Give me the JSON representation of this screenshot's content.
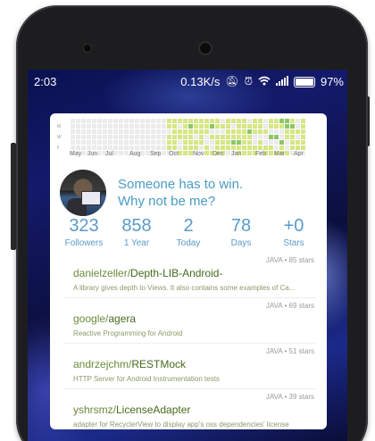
{
  "status_bar": {
    "time": "2:03",
    "net_speed": "0.13K/s",
    "battery_percent": "97%"
  },
  "contribution_graph": {
    "day_labels": [
      "M",
      "W",
      "F"
    ],
    "month_labels": [
      "May",
      "Jun",
      "Jul",
      "Aug",
      "Sep",
      "Oct",
      "Nov",
      "Dec",
      "Jan",
      "Feb",
      "Mar",
      "Apr"
    ],
    "colors": {
      "empty": "#ebebeb",
      "l1": "#d6e685",
      "l2": "#8cc665",
      "l3": "#44a340",
      "l4": "#1e6823"
    }
  },
  "profile": {
    "quote_line1": "Someone has to win.",
    "quote_line2": "Why not be me?"
  },
  "stats": [
    {
      "value": "323",
      "label": "Followers"
    },
    {
      "value": "858",
      "label": "1 Year"
    },
    {
      "value": "2",
      "label": "Today"
    },
    {
      "value": "78",
      "label": "Days"
    },
    {
      "value": "+0",
      "label": "Stars"
    }
  ],
  "repos": [
    {
      "owner": "danielzeller/",
      "name": "Depth-LIB-Android-",
      "lang_stars": "JAVA • 85 stars",
      "description": "A library gives depth to Views. It also contains some examples of Ca..."
    },
    {
      "owner": "google/",
      "name": "agera",
      "lang_stars": "JAVA • 69 stars",
      "description": "Reactive Programming for Android"
    },
    {
      "owner": "andrzejchm/",
      "name": "RESTMock",
      "lang_stars": "JAVA • 51 stars",
      "description": "HTTP Server for Android Instrumentation tests"
    },
    {
      "owner": "yshrsmz/",
      "name": "LicenseAdapter",
      "lang_stars": "JAVA • 39 stars",
      "description": "adapter for RecyclerView to display app's oss dependencies' license"
    }
  ]
}
